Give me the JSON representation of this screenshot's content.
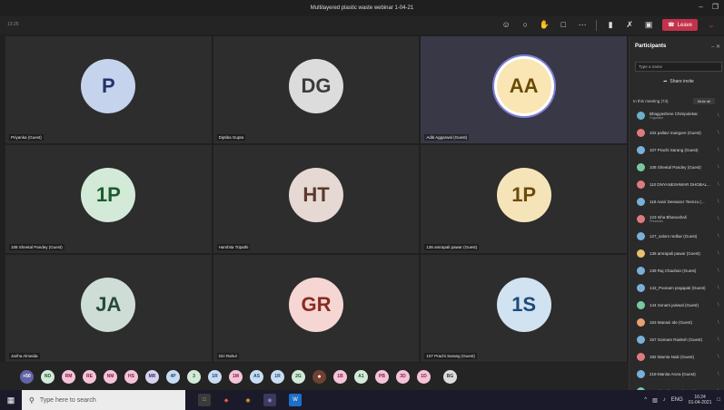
{
  "window": {
    "title": "Multilayered plastic waste webinar 1-04-21"
  },
  "toolbar": {
    "timer": "13:25",
    "leave_label": "Leave"
  },
  "grid": [
    {
      "initials": "P",
      "name": "Priyanka (Guest)",
      "bg": "#c5d3ec",
      "fg": "#22346b",
      "speaking": false
    },
    {
      "initials": "DG",
      "name": "Diptiba Gupta",
      "bg": "#dcdcdc",
      "fg": "#3b3b3b",
      "speaking": false
    },
    {
      "initials": "AA",
      "name": "Aditi Aggarwal (Guest)",
      "bg": "#f9e6b4",
      "fg": "#6a4b07",
      "speaking": true
    },
    {
      "initials": "1P",
      "name": "108 Sheetal Pandey (Guest)",
      "bg": "#d3ead8",
      "fg": "#1d5b30",
      "speaking": false
    },
    {
      "initials": "HT",
      "name": "Harshita Tripathi",
      "bg": "#e6d8d2",
      "fg": "#5a3a2e",
      "speaking": false
    },
    {
      "initials": "1P",
      "name": "136 amrapali pawar (Guest)",
      "bg": "#f6e4b9",
      "fg": "#6b4c0a",
      "speaking": false
    },
    {
      "initials": "JA",
      "name": "Jariha Almeida",
      "bg": "#cfddd7",
      "fg": "#244a3f",
      "speaking": false
    },
    {
      "initials": "GR",
      "name": "Giri Rahul",
      "bg": "#f5d6d2",
      "fg": "#8a2b22",
      "speaking": false
    },
    {
      "initials": "1S",
      "name": "107 Prachi Sarang (Guest)",
      "bg": "#d1e2f1",
      "fg": "#1d4a78",
      "speaking": false
    }
  ],
  "strip": [
    {
      "label": "+50",
      "bg": "#6264a7",
      "fg": "#ffffff"
    },
    {
      "label": "ND",
      "bg": "#d3ead8",
      "fg": "#1d5b30"
    },
    {
      "label": "RM",
      "bg": "#f5c3d7",
      "fg": "#7c1d46"
    },
    {
      "label": "RE",
      "bg": "#f5c3d7",
      "fg": "#7c1d46"
    },
    {
      "label": "NM",
      "bg": "#f5c3d7",
      "fg": "#7c1d46"
    },
    {
      "label": "HS",
      "bg": "#f5c3d7",
      "fg": "#7c1d46"
    },
    {
      "label": "MR",
      "bg": "#d8d3ec",
      "fg": "#3a2f7a"
    },
    {
      "label": "4P",
      "bg": "#c9ddf2",
      "fg": "#1d4a78"
    },
    {
      "label": "3",
      "bg": "#d3ead8",
      "fg": "#1d5b30"
    },
    {
      "label": "1R",
      "bg": "#c9ddf2",
      "fg": "#1d4a78"
    },
    {
      "label": "1M",
      "bg": "#f5c3d7",
      "fg": "#7c1d46"
    },
    {
      "label": "AS",
      "bg": "#c9ddf2",
      "fg": "#1d4a78"
    },
    {
      "label": "1R",
      "bg": "#c9ddf2",
      "fg": "#1d4a78"
    },
    {
      "label": "2G",
      "bg": "#d3ead8",
      "fg": "#1d5b30"
    },
    {
      "label": "1B",
      "bg": "#f5c3d7",
      "fg": "#7c1d46"
    },
    {
      "label": "A1",
      "bg": "#d3ead8",
      "fg": "#1d5b30"
    },
    {
      "label": "PB",
      "bg": "#f5c3d7",
      "fg": "#7c1d46"
    },
    {
      "label": "3D",
      "bg": "#f5c3d7",
      "fg": "#7c1d46"
    },
    {
      "label": "1D",
      "bg": "#f5c3d7",
      "fg": "#7c1d46"
    },
    {
      "label": "BG",
      "bg": "#dcdcdc",
      "fg": "#333333"
    }
  ],
  "panel": {
    "title": "Participants",
    "search_placeholder": "Type a name",
    "share_invite": "Share invite",
    "section": "In this meeting (74)",
    "mute_all": "Mute all",
    "participants": [
      {
        "name": "Bhagyashree Chimpolekar",
        "sub": "Organiser",
        "color": "#6bb0c8"
      },
      {
        "name": "102 pallavi mangore (Guest)",
        "sub": "",
        "color": "#e07a7a"
      },
      {
        "name": "107 Prachi Sarang (Guest)",
        "sub": "",
        "color": "#7ab0d8"
      },
      {
        "name": "108 Sheetal Pandey (Guest)",
        "sub": "",
        "color": "#7ac8a0"
      },
      {
        "name": "110 DNYANESHWAR DHOBAL...",
        "sub": "",
        "color": "#e07a7a"
      },
      {
        "name": "118 Aasir Deewanz Teenzu (...",
        "sub": "",
        "color": "#7ab0d8"
      },
      {
        "name": "123 Isha Bhanushali",
        "sub": "Presenter",
        "color": "#e07a7a"
      },
      {
        "name": "127_salom redkar (Guest)",
        "sub": "",
        "color": "#7ab0d8"
      },
      {
        "name": "136 amrapali pawar (Guest)",
        "sub": "",
        "color": "#e8c070"
      },
      {
        "name": "139 Raj Chauhan (Guest)",
        "sub": "",
        "color": "#7ab0d8"
      },
      {
        "name": "142_Poonam prajapati (Guest)",
        "sub": "",
        "color": "#7ab0d8"
      },
      {
        "name": "144 Sonam jaiswal (Guest)",
        "sub": "",
        "color": "#7ac8a0"
      },
      {
        "name": "153 Manasi Ide (Guest)",
        "sub": "",
        "color": "#e8a070"
      },
      {
        "name": "157 Gamare Radesh (Guest)",
        "sub": "",
        "color": "#7ab0d8"
      },
      {
        "name": "182 Mamta Naik (Guest)",
        "sub": "",
        "color": "#e07a7a"
      },
      {
        "name": "218-Manita Arora (Guest)",
        "sub": "",
        "color": "#7ab0d8"
      },
      {
        "name": "234-dewali gupta (Guest)",
        "sub": "",
        "color": "#7ac8a0"
      }
    ]
  },
  "taskbar": {
    "search_placeholder": "Type here to search",
    "lang": "ENG",
    "time": "16:24",
    "date": "01-04-2021"
  }
}
